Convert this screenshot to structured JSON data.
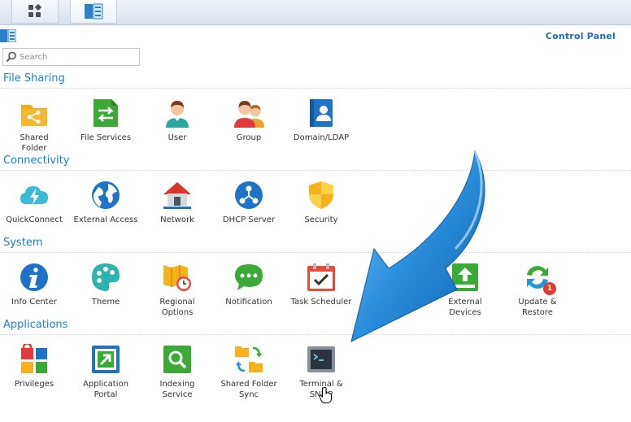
{
  "window": {
    "title": "Control Panel"
  },
  "taskbar": [
    {
      "name": "main-menu-button",
      "icon": "grid-icon"
    },
    {
      "name": "control-panel-taskbar-button",
      "icon": "control-panel-icon"
    }
  ],
  "search": {
    "placeholder": "Search",
    "value": ""
  },
  "sections": [
    {
      "title": "File Sharing",
      "items": [
        {
          "label": "Shared\nFolder",
          "icon": "shared-folder-icon"
        },
        {
          "label": "File Services",
          "icon": "file-services-icon"
        },
        {
          "label": "User",
          "icon": "user-icon"
        },
        {
          "label": "Group",
          "icon": "group-icon"
        },
        {
          "label": "Domain/LDAP",
          "icon": "domain-ldap-icon"
        }
      ]
    },
    {
      "title": "Connectivity",
      "items": [
        {
          "label": "QuickConnect",
          "icon": "quickconnect-icon"
        },
        {
          "label": "External Access",
          "icon": "external-access-icon"
        },
        {
          "label": "Network",
          "icon": "network-icon"
        },
        {
          "label": "DHCP Server",
          "icon": "dhcp-server-icon"
        },
        {
          "label": "Security",
          "icon": "security-icon"
        }
      ]
    },
    {
      "title": "System",
      "items": [
        {
          "label": "Info Center",
          "icon": "info-center-icon"
        },
        {
          "label": "Theme",
          "icon": "theme-icon"
        },
        {
          "label": "Regional\nOptions",
          "icon": "regional-options-icon"
        },
        {
          "label": "Notification",
          "icon": "notification-icon"
        },
        {
          "label": "Task Scheduler",
          "icon": "task-scheduler-icon"
        },
        {
          "label": "External\nDevices",
          "icon": "external-devices-icon"
        },
        {
          "label": "Update &\nRestore",
          "icon": "update-restore-icon",
          "badge": "1"
        }
      ]
    },
    {
      "title": "Applications",
      "items": [
        {
          "label": "Privileges",
          "icon": "privileges-icon"
        },
        {
          "label": "Application\nPortal",
          "icon": "application-portal-icon"
        },
        {
          "label": "Indexing\nService",
          "icon": "indexing-service-icon"
        },
        {
          "label": "Shared Folder\nSync",
          "icon": "shared-folder-sync-icon"
        },
        {
          "label": "Terminal &\nSNMP",
          "icon": "terminal-snmp-icon"
        }
      ]
    }
  ],
  "colors": {
    "accent": "#1a82c9",
    "title": "#1f6fb8",
    "arrow": "#1e88d8"
  }
}
